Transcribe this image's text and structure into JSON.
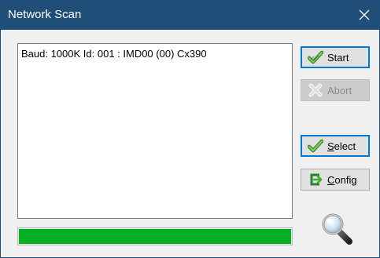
{
  "window": {
    "title": "Network Scan",
    "close_glyph": "✕"
  },
  "scan_results": {
    "items": [
      "Baud: 1000K  Id: 001 : IMD00 (00) Cx390"
    ]
  },
  "progress": {
    "fraction": 1.0,
    "color": "#06b025"
  },
  "buttons": {
    "start": {
      "label": "Start",
      "icon": "green-checkmark-icon",
      "enabled": true
    },
    "abort": {
      "label": "Abort",
      "icon": "x-mark-icon",
      "enabled": false
    },
    "select": {
      "label_underlined": "S",
      "label_rest": "elect",
      "icon": "green-checkmark-icon",
      "enabled": true
    },
    "config": {
      "label_underlined": "C",
      "label_rest": "onfig",
      "icon": "green-arrow-icon",
      "enabled": true
    }
  },
  "decor": {
    "magnifier_icon": "magnifying-glass-icon"
  },
  "colors": {
    "titlebar": "#1f4e79",
    "focus_border": "#0078d7",
    "progress": "#06b025"
  }
}
